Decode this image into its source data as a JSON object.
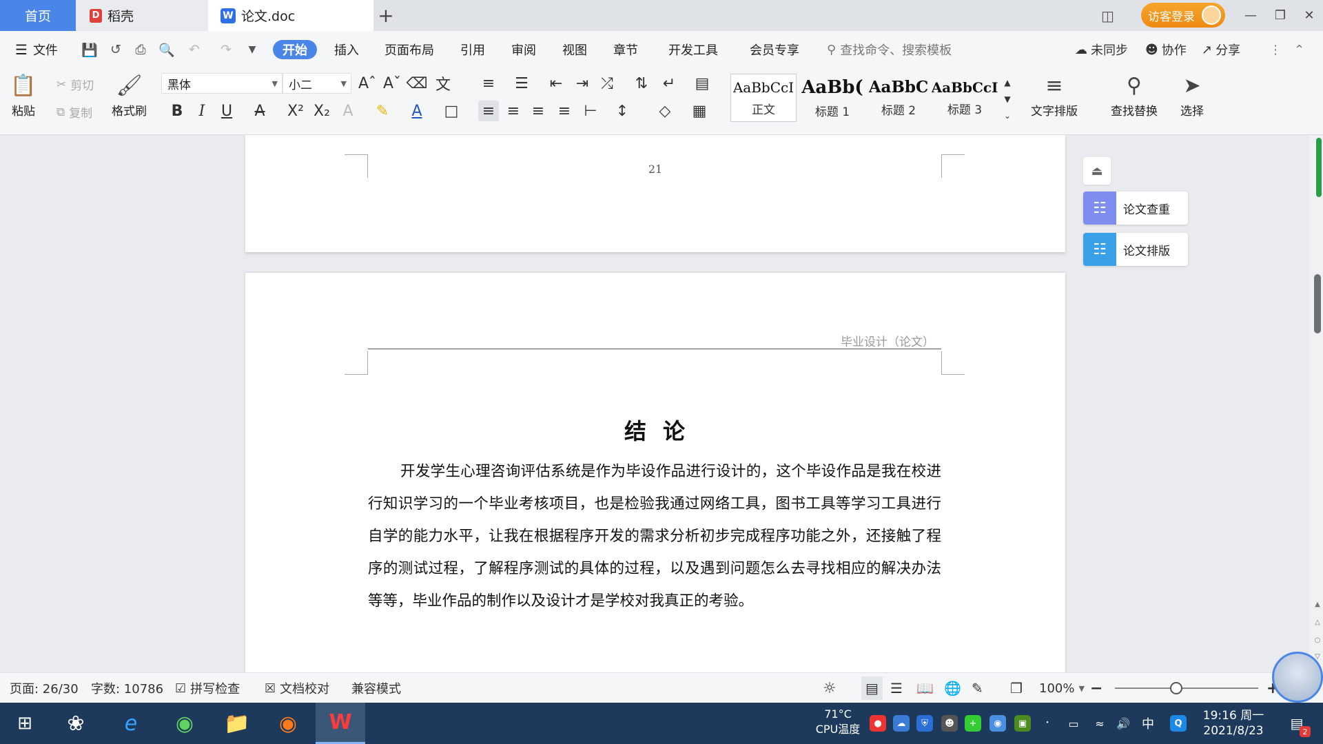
{
  "tabs": {
    "home": "首页",
    "daoke": "稻壳",
    "doc": "论文.doc",
    "add": "+",
    "login": "访客登录"
  },
  "menubar": {
    "file": "文件",
    "items": [
      "开始",
      "插入",
      "页面布局",
      "引用",
      "审阅",
      "视图",
      "章节",
      "开发工具",
      "会员专享"
    ],
    "search_placeholder": "查找命令、搜索模板",
    "sync": "未同步",
    "collab": "协作",
    "share": "分享"
  },
  "ribbon": {
    "paste": "粘贴",
    "cut": "剪切",
    "copy": "复制",
    "format_painter": "格式刷",
    "font_name": "黑体",
    "font_size": "小二",
    "styles": [
      {
        "sample": "AaBbCcI",
        "name": "正文"
      },
      {
        "sample": "AaBb(",
        "name": "标题 1"
      },
      {
        "sample": "AaBbC",
        "name": "标题 2"
      },
      {
        "sample": "AaBbCcI",
        "name": "标题 3"
      }
    ],
    "text_layout": "文字排版",
    "find_replace": "查找替换",
    "select": "选择"
  },
  "document": {
    "page_number": "21",
    "header": "毕业设计（论文）",
    "title": "结论",
    "body": "开发学生心理咨询评估系统是作为毕设作品进行设计的，这个毕设作品是我在校进行知识学习的一个毕业考核项目，也是检验我通过网络工具，图书工具等学习工具进行自学的能力水平，让我在根据程序开发的需求分析初步完成程序功能之外，还接触了程序的测试过程，了解程序测试的具体的过程，以及遇到问题怎么去寻找相应的解决办法等等，毕业作品的制作以及设计才是学校对我真正的考验。"
  },
  "side_panel": {
    "check": "论文查重",
    "format": "论文排版"
  },
  "statusbar": {
    "page": "页面: 26/30",
    "words": "字数: 10786",
    "spell": "拼写检查",
    "proof": "文档校对",
    "compat": "兼容模式",
    "zoom": "100%",
    "zoom_level": 0.43
  },
  "taskbar": {
    "cpu_temp": "71°C",
    "cpu_label": "CPU温度",
    "ime": "中",
    "time": "19:16 周一",
    "date": "2021/8/23",
    "notif_count": "2"
  }
}
